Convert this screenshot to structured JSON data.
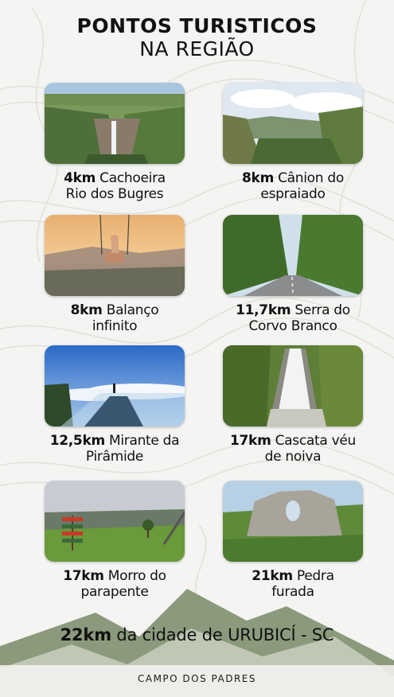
{
  "header": {
    "line1": "PONTOS TURISTICOS",
    "line2": "NA REGIÃO"
  },
  "spots": [
    {
      "distance": "4km",
      "name_line1": "Cachoeira",
      "name_line2": "Rio dos Bugres",
      "photo": "waterfall-canyon-photo"
    },
    {
      "distance": "8km",
      "name_line1": "Cânion do",
      "name_line2": "espraiado",
      "photo": "canyon-valley-photo"
    },
    {
      "distance": "8km",
      "name_line1": "Balanço",
      "name_line2": "infinito",
      "photo": "swing-sunset-photo"
    },
    {
      "distance": "11,7km",
      "name_line1": "Serra do",
      "name_line2": "Corvo Branco",
      "photo": "road-cut-photo"
    },
    {
      "distance": "12,5km",
      "name_line1": "Mirante da",
      "name_line2": "Pirâmide",
      "photo": "glass-lookout-photo"
    },
    {
      "distance": "17km",
      "name_line1": "Cascata véu",
      "name_line2": "de noiva",
      "photo": "bridal-veil-waterfall-photo"
    },
    {
      "distance": "17km",
      "name_line1": "Morro do",
      "name_line2": "parapente",
      "photo": "paragliding-hill-photo"
    },
    {
      "distance": "21km",
      "name_line1": "Pedra",
      "name_line2": "furada",
      "photo": "pierced-rock-photo"
    }
  ],
  "footer": {
    "distance": "22km",
    "text": "da cidade de URUBICÍ - SC",
    "brand": "CAMPO DOS PADRES"
  },
  "colors": {
    "mountain": "#8b9a7c",
    "background": "#f4f4f2",
    "topo_lines": "#e2e2de"
  }
}
